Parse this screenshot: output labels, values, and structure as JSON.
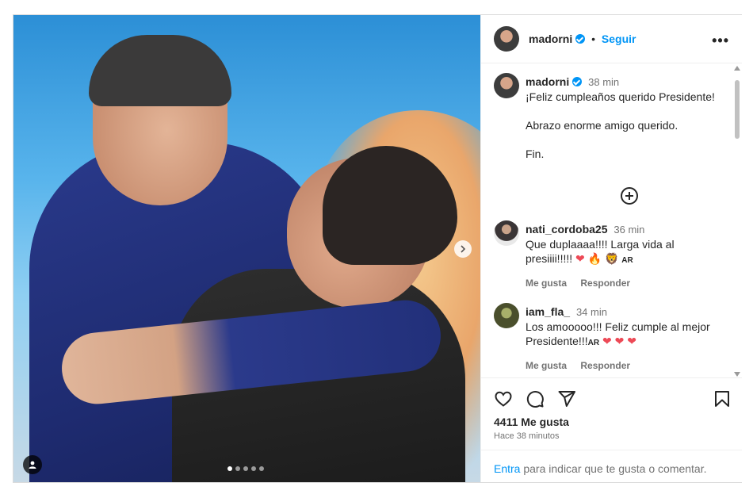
{
  "post": {
    "author": "madorni",
    "follow_label": "Seguir",
    "more_label": "•••",
    "caption_time": "38 min",
    "caption_lines": [
      "¡Feliz cumpleaños querido Presidente!",
      "Abrazo enorme amigo querido.",
      "Fin."
    ],
    "likes": "4411 Me gusta",
    "posted_ago": "Hace 38 minutos"
  },
  "comments": [
    {
      "user": "nati_cordoba25",
      "time": "36 min",
      "text": "Que duplaaaa!!!! Larga vida al presiiii!!!!!",
      "emojis": "❤ 🔥 🦁",
      "flag": "AR",
      "like_label": "Me gusta",
      "reply_label": "Responder"
    },
    {
      "user": "iam_fla_",
      "time": "34 min",
      "text": "Los amooooo!!! Feliz cumple al mejor Presidente!!!",
      "flag": "AR",
      "emojis": "❤ ❤ ❤",
      "like_label": "Me gusta",
      "reply_label": "Responder"
    }
  ],
  "login_bar": {
    "link": "Entra",
    "text": " para indicar que te gusta o comentar."
  },
  "carousel": {
    "count": 5,
    "active_index": 0
  },
  "colors": {
    "accent": "#0095f6",
    "heart": "#ed4956"
  },
  "icons": [
    "heart-icon",
    "comment-icon",
    "share-icon",
    "bookmark-icon",
    "add-comment-icon",
    "tag-user-icon",
    "chevron-right-icon",
    "verified-icon"
  ]
}
